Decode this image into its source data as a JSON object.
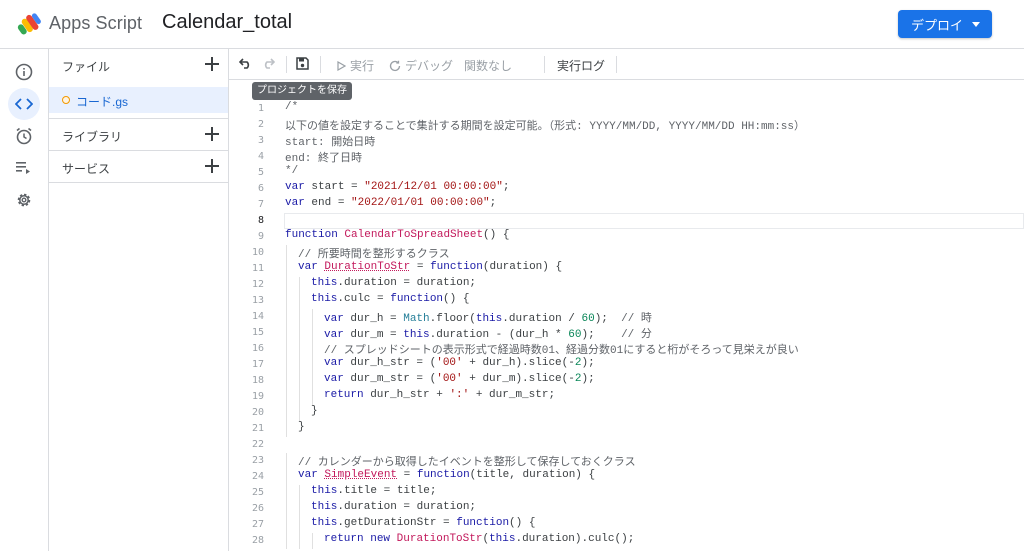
{
  "header": {
    "app_name": "Apps Script",
    "project_title": "Calendar_total",
    "deploy_label": "デプロイ"
  },
  "rail": {
    "items": [
      "overview-icon",
      "editor-icon",
      "triggers-icon",
      "executions-icon",
      "settings-icon"
    ],
    "active": "editor-icon"
  },
  "files_panel": {
    "files_label": "ファイル",
    "file_name": "コード.gs",
    "libraries_label": "ライブラリ",
    "services_label": "サービス"
  },
  "toolbar": {
    "run_label": "実行",
    "debug_label": "デバッグ",
    "function_label": "関数なし",
    "log_label": "実行ログ",
    "save_tooltip": "プロジェクトを保存"
  },
  "editor": {
    "current_line": 8,
    "lines": [
      {
        "n": "1",
        "indent": 0,
        "t": [
          [
            "/*",
            "c"
          ]
        ]
      },
      {
        "n": "2",
        "indent": 0,
        "t": [
          [
            "以下の値を設定することで集計する期間を設定可能。（形式: YYYY/MM/DD, YYYY/MM/DD HH:mm:ss）",
            "c"
          ]
        ]
      },
      {
        "n": "3",
        "indent": 0,
        "t": [
          [
            "start: 開始日時",
            "c"
          ]
        ]
      },
      {
        "n": "4",
        "indent": 0,
        "t": [
          [
            "end: 終了日時",
            "c"
          ]
        ]
      },
      {
        "n": "5",
        "indent": 0,
        "t": [
          [
            "*/",
            "c"
          ]
        ]
      },
      {
        "n": "6",
        "indent": 0,
        "t": [
          [
            "var",
            "k"
          ],
          [
            " start = ",
            "p"
          ],
          [
            "\"2021/12/01 00:00:00\"",
            "s"
          ],
          [
            ";",
            "p"
          ]
        ]
      },
      {
        "n": "7",
        "indent": 0,
        "t": [
          [
            "var",
            "k"
          ],
          [
            " end = ",
            "p"
          ],
          [
            "\"2022/01/01 00:00:00\"",
            "s"
          ],
          [
            ";",
            "p"
          ]
        ]
      },
      {
        "n": "8",
        "indent": 0,
        "t": []
      },
      {
        "n": "9",
        "indent": 0,
        "t": [
          [
            "function",
            "k"
          ],
          [
            " ",
            "p"
          ],
          [
            "CalendarToSpreadSheet",
            "f"
          ],
          [
            "() {",
            "p"
          ]
        ]
      },
      {
        "n": "10",
        "indent": 1,
        "t": [
          [
            "// 所要時間を整形するクラス",
            "c"
          ]
        ]
      },
      {
        "n": "11",
        "indent": 1,
        "t": [
          [
            "var",
            "k"
          ],
          [
            " ",
            "p"
          ],
          [
            "DurationToStr",
            "fu"
          ],
          [
            " = ",
            "p"
          ],
          [
            "function",
            "k"
          ],
          [
            "(duration) {",
            "p"
          ]
        ]
      },
      {
        "n": "12",
        "indent": 2,
        "t": [
          [
            "this",
            "k"
          ],
          [
            ".duration = duration;",
            "p"
          ]
        ]
      },
      {
        "n": "13",
        "indent": 2,
        "t": [
          [
            "this",
            "k"
          ],
          [
            ".culc = ",
            "p"
          ],
          [
            "function",
            "k"
          ],
          [
            "() {",
            "p"
          ]
        ]
      },
      {
        "n": "14",
        "indent": 3,
        "t": [
          [
            "var",
            "k"
          ],
          [
            " dur_h = ",
            "p"
          ],
          [
            "Math",
            "t"
          ],
          [
            ".floor(",
            "p"
          ],
          [
            "this",
            "k"
          ],
          [
            ".duration / ",
            "p"
          ],
          [
            "60",
            "n"
          ],
          [
            ");  ",
            "p"
          ],
          [
            "// 時",
            "c"
          ]
        ]
      },
      {
        "n": "15",
        "indent": 3,
        "t": [
          [
            "var",
            "k"
          ],
          [
            " dur_m = ",
            "p"
          ],
          [
            "this",
            "k"
          ],
          [
            ".duration - (dur_h * ",
            "p"
          ],
          [
            "60",
            "n"
          ],
          [
            ");    ",
            "p"
          ],
          [
            "// 分",
            "c"
          ]
        ]
      },
      {
        "n": "16",
        "indent": 3,
        "t": [
          [
            "// スプレッドシートの表示形式で経過時数01、経過分数01にすると桁がそろって見栄えが良い",
            "c"
          ]
        ]
      },
      {
        "n": "17",
        "indent": 3,
        "t": [
          [
            "var",
            "k"
          ],
          [
            " dur_h_str = (",
            "p"
          ],
          [
            "'00'",
            "s"
          ],
          [
            " + dur_h).slice(-",
            "p"
          ],
          [
            "2",
            "n"
          ],
          [
            ");",
            "p"
          ]
        ]
      },
      {
        "n": "18",
        "indent": 3,
        "t": [
          [
            "var",
            "k"
          ],
          [
            " dur_m_str = (",
            "p"
          ],
          [
            "'00'",
            "s"
          ],
          [
            " + dur_m).slice(-",
            "p"
          ],
          [
            "2",
            "n"
          ],
          [
            ");",
            "p"
          ]
        ]
      },
      {
        "n": "19",
        "indent": 3,
        "t": [
          [
            "return",
            "k"
          ],
          [
            " dur_h_str + ",
            "p"
          ],
          [
            "':'",
            "s"
          ],
          [
            " + dur_m_str;",
            "p"
          ]
        ]
      },
      {
        "n": "20",
        "indent": 2,
        "t": [
          [
            "}",
            "p"
          ]
        ]
      },
      {
        "n": "21",
        "indent": 1,
        "t": [
          [
            "}",
            "p"
          ]
        ]
      },
      {
        "n": "22",
        "indent": 0,
        "t": []
      },
      {
        "n": "23",
        "indent": 1,
        "t": [
          [
            "// カレンダーから取得したイベントを整形して保存しておくクラス",
            "c"
          ]
        ]
      },
      {
        "n": "24",
        "indent": 1,
        "t": [
          [
            "var",
            "k"
          ],
          [
            " ",
            "p"
          ],
          [
            "SimpleEvent",
            "fu"
          ],
          [
            " = ",
            "p"
          ],
          [
            "function",
            "k"
          ],
          [
            "(title, duration) {",
            "p"
          ]
        ]
      },
      {
        "n": "25",
        "indent": 2,
        "t": [
          [
            "this",
            "k"
          ],
          [
            ".title = title;",
            "p"
          ]
        ]
      },
      {
        "n": "26",
        "indent": 2,
        "t": [
          [
            "this",
            "k"
          ],
          [
            ".duration = duration;",
            "p"
          ]
        ]
      },
      {
        "n": "27",
        "indent": 2,
        "t": [
          [
            "this",
            "k"
          ],
          [
            ".getDurationStr = ",
            "p"
          ],
          [
            "function",
            "k"
          ],
          [
            "() {",
            "p"
          ]
        ]
      },
      {
        "n": "28",
        "indent": 3,
        "t": [
          [
            "return",
            "k"
          ],
          [
            " ",
            "p"
          ],
          [
            "new",
            "k"
          ],
          [
            " ",
            "p"
          ],
          [
            "DurationToStr",
            "f"
          ],
          [
            "(",
            "p"
          ],
          [
            "this",
            "k"
          ],
          [
            ".duration).culc();",
            "p"
          ]
        ]
      }
    ]
  },
  "colors": {
    "accent": "#1a73e8",
    "keyword": "#1a1aa6",
    "function": "#c2185b",
    "string": "#a31515",
    "number": "#098658",
    "type": "#267f99",
    "comment": "#5f6368"
  }
}
